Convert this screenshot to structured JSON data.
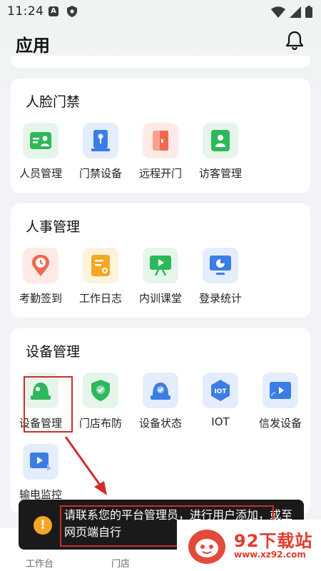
{
  "status_bar": {
    "time": "11:24",
    "notif_a": "A"
  },
  "header": {
    "title": "应用"
  },
  "sections": [
    {
      "title": "人脸门禁",
      "items": [
        {
          "label": "人员管理",
          "icon": "person-card-icon",
          "bg": "#e6f5ea",
          "fg": "#2eb85c"
        },
        {
          "label": "门禁设备",
          "icon": "door-device-icon",
          "bg": "#e4edfb",
          "fg": "#3b7de6"
        },
        {
          "label": "远程开门",
          "icon": "door-open-icon",
          "bg": "#fdeae6",
          "fg": "#f06a4f"
        },
        {
          "label": "访客管理",
          "icon": "visitor-icon",
          "bg": "#e6f5ea",
          "fg": "#2eb85c"
        }
      ]
    },
    {
      "title": "人事管理",
      "items": [
        {
          "label": "考勤签到",
          "icon": "clock-pin-icon",
          "bg": "#fdeae6",
          "fg": "#f06a4f"
        },
        {
          "label": "工作日志",
          "icon": "log-icon",
          "bg": "#fdf2dc",
          "fg": "#f5a623"
        },
        {
          "label": "内训课堂",
          "icon": "training-board-icon",
          "bg": "#e6f5ea",
          "fg": "#2eb85c"
        },
        {
          "label": "登录统计",
          "icon": "stats-monitor-icon",
          "bg": "#e4edfb",
          "fg": "#3b7de6"
        }
      ]
    },
    {
      "title": "设备管理",
      "items": [
        {
          "label": "设备管理",
          "icon": "camera-dome-icon",
          "bg": "#e6f5ea",
          "fg": "#2eb85c"
        },
        {
          "label": "门店布防",
          "icon": "shield-check-icon",
          "bg": "#e6f5ea",
          "fg": "#2eb85c"
        },
        {
          "label": "设备状态",
          "icon": "device-status-icon",
          "bg": "#e4edfb",
          "fg": "#3b7de6"
        },
        {
          "label": "IOT",
          "icon": "iot-icon",
          "bg": "#e4edfb",
          "fg": "#3b7de6"
        },
        {
          "label": "信发设备",
          "icon": "signage-icon",
          "bg": "#e4edfb",
          "fg": "#3b7de6"
        },
        {
          "label": "输电监控",
          "icon": "power-monitor-icon",
          "bg": "#e4edfb",
          "fg": "#3b7de6"
        }
      ]
    }
  ],
  "bottom_nav": {
    "workbench": "工作台",
    "store": "门店"
  },
  "toast": {
    "icon_glyph": "!",
    "message": "请联系您的平台管理员，进行用户添加，或至网页端自行"
  },
  "watermark": {
    "text": "92下载站",
    "url": "www.xz92.com"
  },
  "colors": {
    "accent_red": "#d22b2b",
    "green": "#2eb85c",
    "blue": "#3b7de6"
  }
}
